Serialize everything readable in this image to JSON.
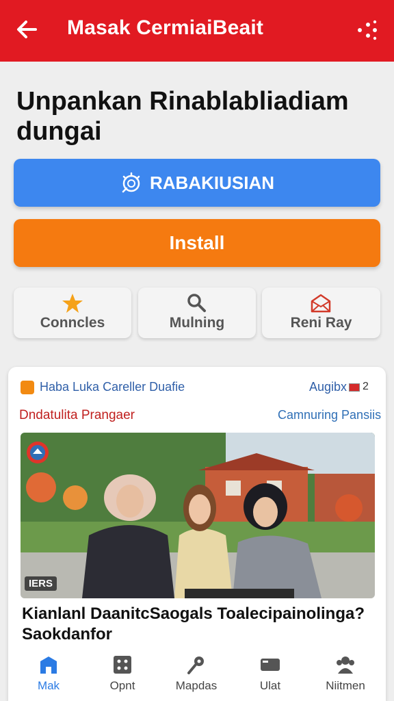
{
  "appbar": {
    "title": "Masak CermiaiBeait",
    "back_icon": "arrow-left-icon",
    "more_icon": "share-dots-icon",
    "color": "#e11a22"
  },
  "headline": "Unpankan Rinablabliadiam dungai",
  "primary_button": {
    "label": "RABAKIUSIAN",
    "icon": "badge-gear-icon",
    "color": "#3d87ef"
  },
  "install_button": {
    "label": "Install",
    "color": "#f57a10"
  },
  "tiles": [
    {
      "label": "Conncles",
      "icon": "star-icon"
    },
    {
      "label": "Mulning",
      "icon": "search-icon"
    },
    {
      "label": "Reni Ray",
      "icon": "envelope-icon"
    }
  ],
  "card": {
    "source": "Haba Luka Careller Duafie",
    "meta": "Augibx",
    "count": "2",
    "sub_left": "Dndatulita Prangaer",
    "sub_right": "Camnuring Pansiis",
    "photo_badge": "IERS",
    "story_title": "Kianlanl DaanitcSaogals Toalecipainolinga? Saokdanfor"
  },
  "bottom_nav": [
    {
      "label": "Mak",
      "icon": "home-icon",
      "active": true
    },
    {
      "label": "Opnt",
      "icon": "grid-icon",
      "active": false
    },
    {
      "label": "Mapdas",
      "icon": "map-pin-icon",
      "active": false
    },
    {
      "label": "Ulat",
      "icon": "tv-icon",
      "active": false
    },
    {
      "label": "Niitmen",
      "icon": "people-icon",
      "active": false
    }
  ]
}
